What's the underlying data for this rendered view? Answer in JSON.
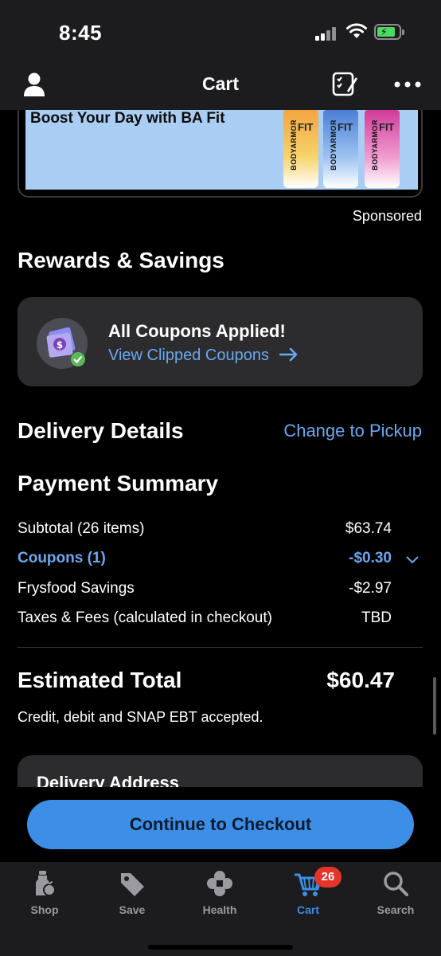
{
  "status": {
    "time": "8:45"
  },
  "nav": {
    "title": "Cart"
  },
  "banner": {
    "headline": "Boost Your Day with BA Fit",
    "can_brand": "BODYARMOR",
    "can_label": "FIT",
    "sponsored": "Sponsored"
  },
  "rewards": {
    "heading": "Rewards & Savings",
    "coupon_title": "All Coupons Applied!",
    "coupon_link": "View Clipped Coupons"
  },
  "delivery": {
    "heading": "Delivery Details",
    "change_link": "Change to Pickup"
  },
  "payment": {
    "heading": "Payment Summary",
    "rows": [
      {
        "label": "Subtotal (26 items)",
        "value": "$63.74"
      },
      {
        "label": "Coupons (1)",
        "value": "-$0.30"
      },
      {
        "label": "Frysfood Savings",
        "value": "-$2.97"
      },
      {
        "label": "Taxes & Fees (calculated in checkout)",
        "value": "TBD"
      }
    ],
    "total_label": "Estimated Total",
    "total_value": "$60.47",
    "accepted": "Credit, debit and SNAP EBT accepted."
  },
  "address": {
    "heading": "Delivery Address"
  },
  "checkout": {
    "label": "Continue to Checkout"
  },
  "tabs": [
    {
      "label": "Shop",
      "icon": "shop-icon"
    },
    {
      "label": "Save",
      "icon": "tag-icon"
    },
    {
      "label": "Health",
      "icon": "health-icon"
    },
    {
      "label": "Cart",
      "icon": "cart-icon",
      "badge": "26"
    },
    {
      "label": "Search",
      "icon": "search-icon"
    }
  ],
  "colors": {
    "accent": "#3d8ee6",
    "link": "#6aa8f0",
    "badge": "#e5352b",
    "card": "#2c2c2e"
  }
}
